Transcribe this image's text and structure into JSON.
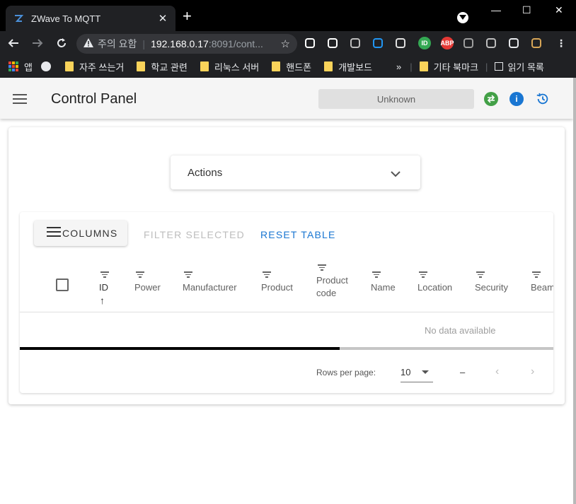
{
  "browser": {
    "tab_title": "ZWave To MQTT",
    "tab_close": "✕",
    "new_tab": "+",
    "address": {
      "security_label": "주의 요함",
      "host": "192.168.0.17",
      "path": ":8091/cont..."
    },
    "window_controls": [
      "—",
      "☐",
      "✕"
    ],
    "bookmarks": [
      {
        "label": "앱",
        "kind": "apps"
      },
      {
        "label": "",
        "kind": "globe"
      },
      {
        "label": "자주 쓰는거",
        "kind": "folder"
      },
      {
        "label": "학교 관련",
        "kind": "folder"
      },
      {
        "label": "리눅스 서버",
        "kind": "folder"
      },
      {
        "label": "핸드폰",
        "kind": "folder"
      },
      {
        "label": "개발보드",
        "kind": "folder"
      }
    ],
    "bookmarks_overflow": "»",
    "other_bookmarks": "기타 북마크",
    "reading_list": "읽기 목록",
    "extensions": [
      {
        "name": "download-ext-icon",
        "label": "",
        "color": "#ffffff"
      },
      {
        "name": "window-ext-icon",
        "label": "",
        "color": "#ffffff"
      },
      {
        "name": "camera-ext-icon",
        "label": "",
        "color": "#bdbdbd"
      },
      {
        "name": "diamond-ext-icon",
        "label": "",
        "color": "#2196f3"
      },
      {
        "name": "cast-ext-icon",
        "label": "",
        "color": "#e0e0e0"
      },
      {
        "name": "id-ext-icon",
        "label": "ID",
        "color": "#34a853"
      },
      {
        "name": "adblock-ext-icon",
        "label": "ABP",
        "color": "#e53935"
      },
      {
        "name": "gear-ext-icon",
        "label": "",
        "color": "#9e9e9e"
      },
      {
        "name": "shield-ext-icon",
        "label": "",
        "color": "#bdbdbd"
      },
      {
        "name": "puzzle-ext-icon",
        "label": "",
        "color": "#e8eaed"
      },
      {
        "name": "doge-ext-icon",
        "label": "",
        "color": "#d8a657"
      }
    ]
  },
  "app": {
    "title": "Control Panel",
    "status": "Unknown",
    "icons": {
      "sync_color": "#43a047",
      "info_color": "#1976d2",
      "history_color": "#1976d2"
    }
  },
  "actions": {
    "label": "Actions"
  },
  "table": {
    "columns_button": "COLUMNS",
    "filter_selected": "FILTER SELECTED",
    "reset_table": "RESET TABLE",
    "headers": [
      "ID",
      "Power",
      "Manufacturer",
      "Product",
      "Product code",
      "Name",
      "Location",
      "Security",
      "Beam"
    ],
    "sort_indicator": "↑",
    "no_data": "No data available",
    "progress_fraction": 0.6,
    "rows_per_page_label": "Rows per page:",
    "rows_per_page_value": "10",
    "range_text": "–",
    "prev": "‹",
    "next": "›"
  }
}
